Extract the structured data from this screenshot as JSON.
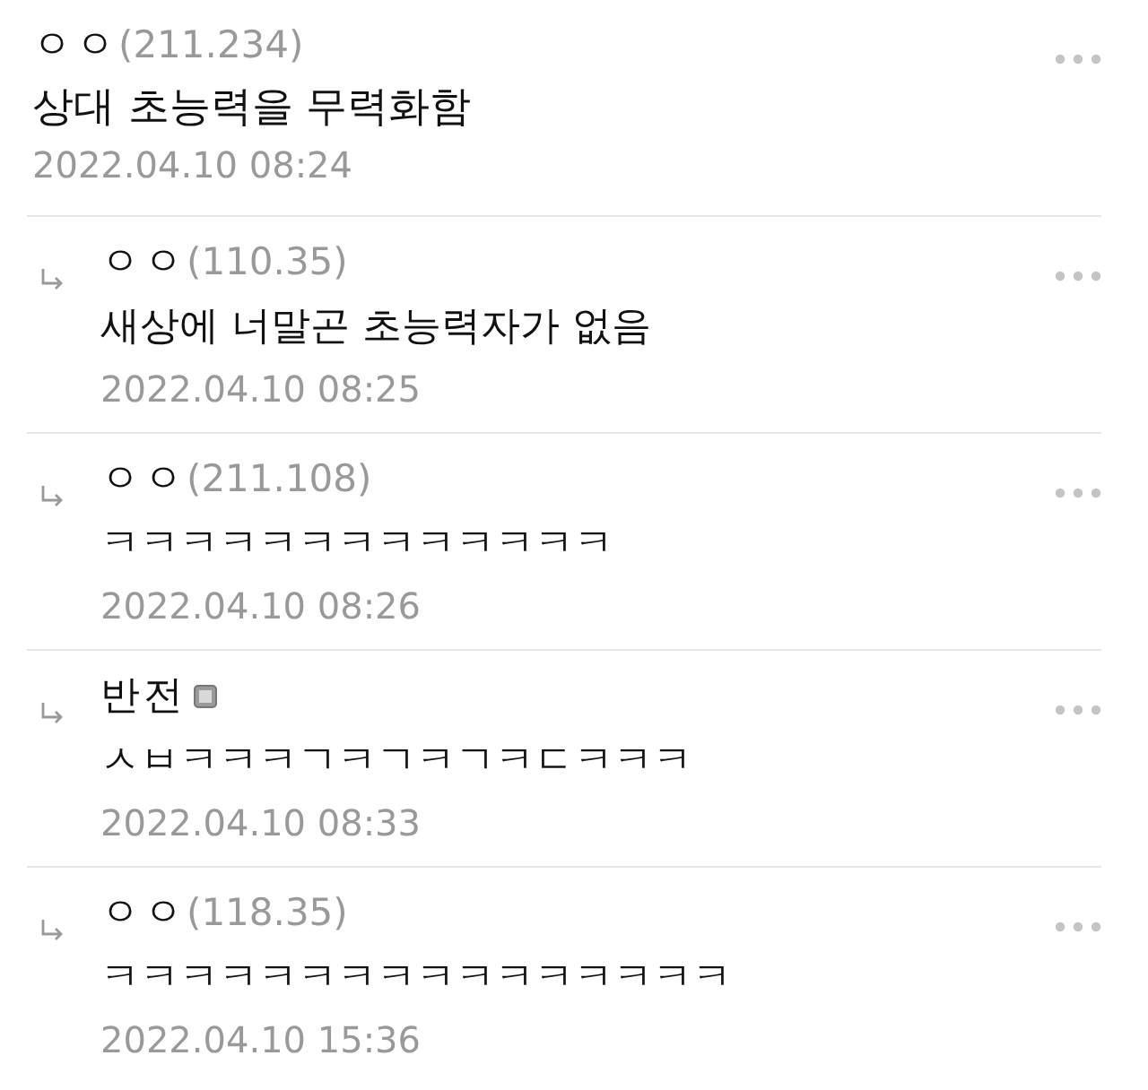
{
  "comments": [
    {
      "kind": "comment",
      "author": "ㅇㅇ",
      "ip": "(211.234)",
      "badge": false,
      "text": "상대 초능력을 무력화함",
      "time": "2022.04.10 08:24"
    },
    {
      "kind": "reply",
      "author": "ㅇㅇ",
      "ip": "(110.35)",
      "badge": false,
      "text": "새상에 너말곤 초능력자가 없음",
      "time": "2022.04.10 08:25"
    },
    {
      "kind": "reply",
      "author": "ㅇㅇ",
      "ip": "(211.108)",
      "badge": false,
      "text": "ㅋㅋㅋㅋㅋㅋㅋㅋㅋㅋㅋㅋㅋ",
      "time": "2022.04.10 08:26"
    },
    {
      "kind": "reply",
      "author": "반전",
      "badge": true,
      "text": "ㅅㅂㅋㅋㅋㄱㅋㄱㅋㄱㅋㄷㅋㅋㅋ",
      "time": "2022.04.10 08:33"
    },
    {
      "kind": "reply",
      "author": "ㅇㅇ",
      "ip": "(118.35)",
      "badge": false,
      "text": "ㅋㅋㅋㅋㅋㅋㅋㅋㅋㅋㅋㅋㅋㅋㅋㅋ",
      "time": "2022.04.10 15:36"
    }
  ]
}
